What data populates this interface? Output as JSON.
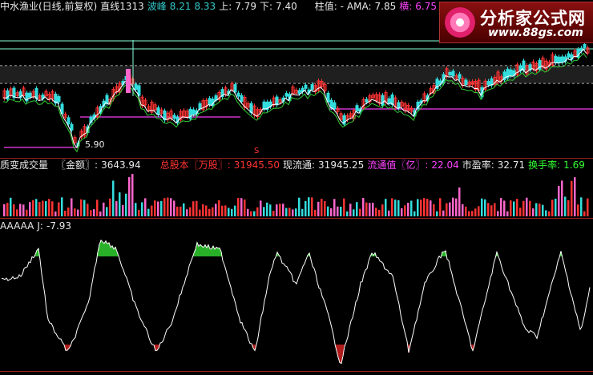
{
  "header_main": {
    "title": "中水渔业(日线,前复权)",
    "line_label": "直线1313",
    "wave_label": "波峰",
    "wave_v1": "8.21",
    "wave_v2": "8.33",
    "up_label": "上:",
    "up_value": "7.79",
    "down_label": "下:",
    "down_value": "7.40",
    "pillar_label": "柱值: -",
    "ama_label": "AMA:",
    "ama_value": "7.85",
    "horiz_label": "横:",
    "horiz_value": "6.75"
  },
  "logo": {
    "title": "分析家公式网",
    "url": "www.88gs.com"
  },
  "price_chart": {
    "low_marker": "5.90",
    "s_marker": "S"
  },
  "header_volume": {
    "label": "质变成交量",
    "amount_label": "〖金额〗:",
    "amount_value": "3643.94",
    "total_share_label": "总股本〖万股〗:",
    "total_share_value": "31945.50",
    "float_label": "现流通:",
    "float_value": "31945.25",
    "float_value_label": "流通值〖亿〗:",
    "float_value_value": "22.04",
    "pe_label": "市盈率:",
    "pe_value": "32.71",
    "turnover_label": "换手率:",
    "turnover_value": "1.69"
  },
  "header_indicator": {
    "name": "AAAAA",
    "j_label": "J:",
    "j_value": "-7.93"
  },
  "colors": {
    "up": "#ff3333",
    "down": "#33dddd",
    "ma": "#ffffff",
    "ama": "#33cc33",
    "support": "#cc33cc",
    "grid": "#9b2222",
    "kdj_high": "#33dd33",
    "kdj_low": "#dd2222"
  }
}
